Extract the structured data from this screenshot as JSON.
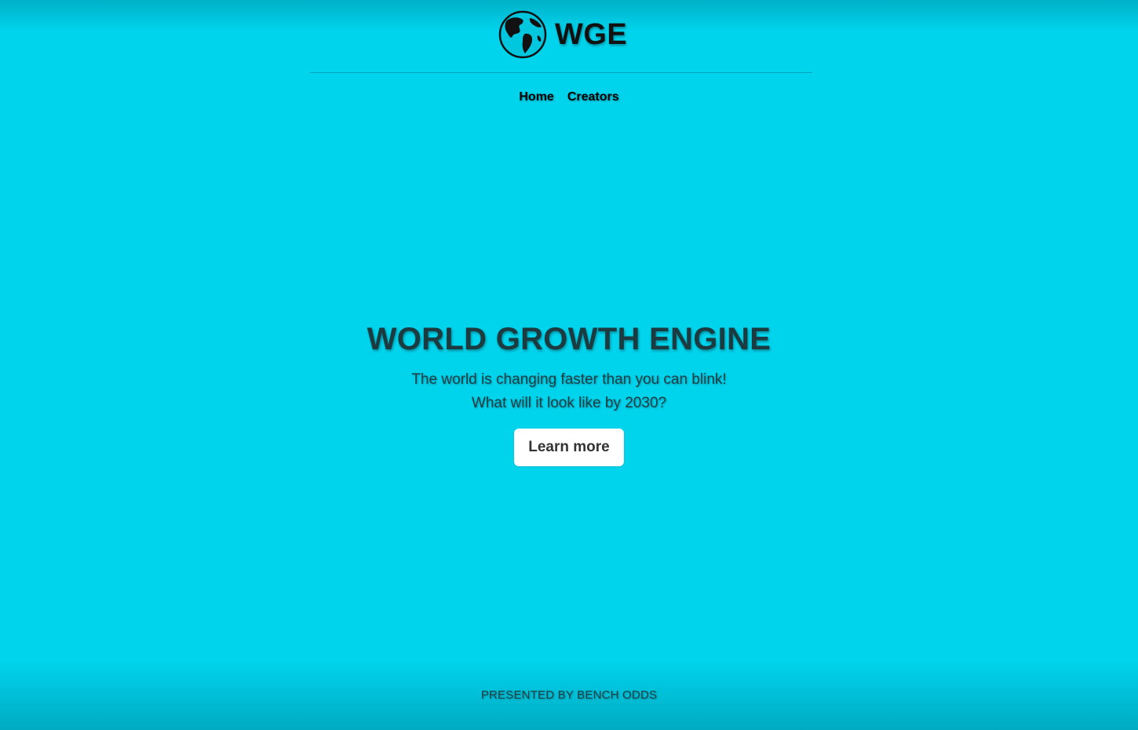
{
  "colors": {
    "background": "#00d4ed",
    "button_bg": "#ffffff",
    "text_dark": "#111111"
  },
  "header": {
    "logo_icon": "globe-icon",
    "brand_text": "WGE"
  },
  "nav": {
    "items": [
      {
        "label": "Home"
      },
      {
        "label": "Creators"
      }
    ]
  },
  "hero": {
    "title": "WORLD GROWTH ENGINE",
    "tagline_line1": "The world is changing faster than you can blink!",
    "tagline_line2": "What will it look like by 2030?",
    "cta_label": "Learn more"
  },
  "footer": {
    "text": "PRESENTED BY BENCH ODDS"
  }
}
